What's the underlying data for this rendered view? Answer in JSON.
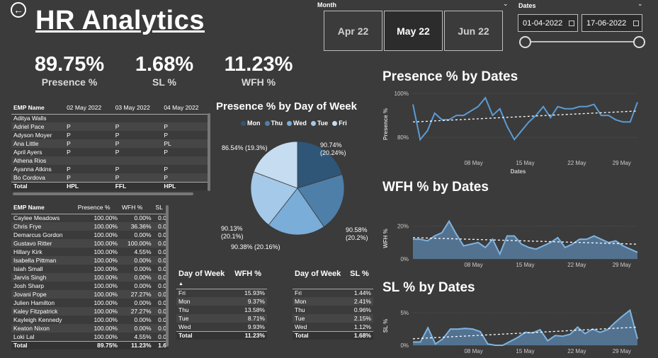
{
  "title": "HR Analytics",
  "kpis": [
    {
      "value": "89.75%",
      "label": "Presence %"
    },
    {
      "value": "1.68%",
      "label": "SL %"
    },
    {
      "value": "11.23%",
      "label": "WFH %"
    }
  ],
  "month_slicer": {
    "label": "Month",
    "options": [
      "Apr 22",
      "May 22",
      "Jun 22"
    ],
    "selected": "May 22"
  },
  "date_slicer": {
    "label": "Dates",
    "start": "01-04-2022",
    "end": "17-06-2022"
  },
  "emp_table1": {
    "headers": [
      "EMP Name",
      "02 May 2022",
      "03 May 2022",
      "04 May 2022"
    ],
    "rows": [
      [
        "Aditya Walls",
        "",
        "",
        ""
      ],
      [
        "Adriel Pace",
        "P",
        "P",
        "P"
      ],
      [
        "Adyson Moyer",
        "P",
        "P",
        "P"
      ],
      [
        "Ana Little",
        "P",
        "P",
        "PL"
      ],
      [
        "April Ayers",
        "P",
        "P",
        "P"
      ],
      [
        "Athena Rios",
        "",
        "",
        ""
      ],
      [
        "Ayanna Atkins",
        "P",
        "P",
        "P"
      ],
      [
        "Bo Cordova",
        "P",
        "P",
        "P"
      ]
    ],
    "total": [
      "Total",
      "HPL",
      "FFL",
      "HPL"
    ]
  },
  "emp_table2": {
    "headers": [
      "EMP Name",
      "Presence %",
      "WFH %",
      "SL"
    ],
    "rows": [
      [
        "Caylee Meadows",
        "100.00%",
        "0.00%",
        "0.0"
      ],
      [
        "Chris Frye",
        "100.00%",
        "36.36%",
        "0.0"
      ],
      [
        "Demarcus Gordon",
        "100.00%",
        "0.00%",
        "0.0"
      ],
      [
        "Gustavo Ritter",
        "100.00%",
        "100.00%",
        "0.0"
      ],
      [
        "Hillary Kirk",
        "100.00%",
        "4.55%",
        "0.0"
      ],
      [
        "Isabella Pittman",
        "100.00%",
        "0.00%",
        "0.0"
      ],
      [
        "Isiah Small",
        "100.00%",
        "0.00%",
        "0.0"
      ],
      [
        "Jarvis Singh",
        "100.00%",
        "0.00%",
        "0.0"
      ],
      [
        "Josh Sharp",
        "100.00%",
        "0.00%",
        "0.0"
      ],
      [
        "Jovani Pope",
        "100.00%",
        "27.27%",
        "0.0"
      ],
      [
        "Julien Hamilton",
        "100.00%",
        "0.00%",
        "0.0"
      ],
      [
        "Kaley Fitzpatrick",
        "100.00%",
        "27.27%",
        "0.0"
      ],
      [
        "Kayleigh Kennedy",
        "100.00%",
        "0.00%",
        "0.0"
      ],
      [
        "Keaton Nixon",
        "100.00%",
        "0.00%",
        "0.0"
      ],
      [
        "Loki Lal",
        "100.00%",
        "4.55%",
        "0.0"
      ]
    ],
    "total": [
      "Total",
      "89.75%",
      "11.23%",
      "1.6"
    ]
  },
  "dow_wfh_table": {
    "headers": [
      "Day of Week",
      "WFH %"
    ],
    "rows": [
      [
        "Fri",
        "15.93%"
      ],
      [
        "Mon",
        "9.37%"
      ],
      [
        "Thu",
        "13.58%"
      ],
      [
        "Tue",
        "8.71%"
      ],
      [
        "Wed",
        "9.93%"
      ]
    ],
    "total": [
      "Total",
      "11.23%"
    ]
  },
  "dow_sl_table": {
    "headers": [
      "Day of Week",
      "SL %"
    ],
    "rows": [
      [
        "Fri",
        "1.44%"
      ],
      [
        "Mon",
        "2.41%"
      ],
      [
        "Thu",
        "0.96%"
      ],
      [
        "Tue",
        "2.15%"
      ],
      [
        "Wed",
        "1.12%"
      ]
    ],
    "total": [
      "Total",
      "1.68%"
    ]
  },
  "chart_data": [
    {
      "type": "pie",
      "title": "Presence % by Day of Week",
      "legend": [
        "Mon",
        "Thu",
        "Wed",
        "Tue",
        "Fri"
      ],
      "legend_position": "top",
      "slices": [
        {
          "name": "Mon",
          "value": 90.74,
          "label": "90.74% (20.24%)",
          "color": "#2f5677"
        },
        {
          "name": "Thu",
          "value": 90.58,
          "label": "90.58% (20.2%)",
          "color": "#4e7fa8"
        },
        {
          "name": "Wed",
          "value": 90.38,
          "label": "90.38% (20.16%)",
          "color": "#7aadd8"
        },
        {
          "name": "Tue",
          "value": 90.13,
          "label": "90.13% (20.1%)",
          "color": "#a5c9e8"
        },
        {
          "name": "Fri",
          "value": 86.54,
          "label": "86.54% (19.3%)",
          "color": "#c6dcf0"
        }
      ]
    },
    {
      "type": "line",
      "title": "Presence % by Dates",
      "ylabel": "Presence %",
      "xlabel": "Dates",
      "yticks": [
        "100%",
        "80%"
      ],
      "ylim": [
        72,
        100
      ],
      "xticks": [
        "08 May",
        "15 May",
        "22 May",
        "29 May"
      ],
      "values": [
        95,
        79,
        83,
        91,
        88,
        88,
        90,
        90,
        92,
        94,
        98,
        90,
        93,
        85,
        79,
        83,
        87,
        90,
        94,
        89,
        94,
        93,
        93,
        94,
        94,
        95,
        90,
        90,
        88,
        87,
        87,
        96
      ],
      "trend": [
        87,
        92
      ],
      "color": "#5b9bd5"
    },
    {
      "type": "area",
      "title": "WFH % by Dates",
      "ylabel": "WFH %",
      "yticks": [
        "20%",
        "0%"
      ],
      "ylim": [
        0,
        25
      ],
      "xticks": [
        "08 May",
        "15 May",
        "22 May",
        "29 May"
      ],
      "values": [
        12,
        12,
        11,
        14,
        16,
        23,
        15,
        8,
        9,
        10,
        7,
        12,
        3,
        14,
        14,
        9,
        7,
        6,
        8,
        10,
        13,
        7,
        9,
        12,
        12,
        14,
        12,
        10,
        11,
        8,
        6,
        4
      ],
      "trend": [
        13,
        9
      ],
      "color": "#5b86ad"
    },
    {
      "type": "area",
      "title": "SL % by Dates",
      "ylabel": "SL %",
      "yticks": [
        "5%",
        "0%"
      ],
      "ylim": [
        0,
        6
      ],
      "xticks": [
        "08 May",
        "15 May",
        "22 May",
        "29 May"
      ],
      "values": [
        0.5,
        0.5,
        2.7,
        0.2,
        1,
        2.5,
        2.5,
        2.6,
        2.5,
        2.1,
        0.2,
        0,
        0,
        0.6,
        1.2,
        2.0,
        1.9,
        2.4,
        0.7,
        1.5,
        1.4,
        1.7,
        2.8,
        1.8,
        2.5,
        2.0,
        2.4,
        3.5,
        4.5,
        5.4,
        1.0
      ],
      "trend": [
        1.0,
        2.8
      ],
      "color": "#5b86ad"
    }
  ]
}
